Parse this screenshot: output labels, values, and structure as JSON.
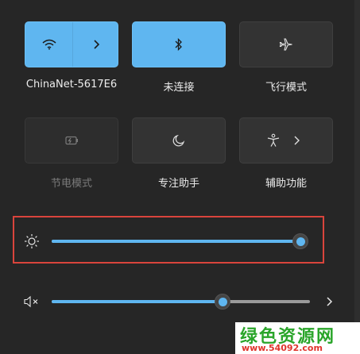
{
  "quick_settings": {
    "tiles": [
      {
        "label": "ChinaNet-5617E6",
        "icon": "wifi-icon",
        "state": "on",
        "has_chevron": true
      },
      {
        "label": "未连接",
        "icon": "bluetooth-icon",
        "state": "on"
      },
      {
        "label": "飞行模式",
        "icon": "airplane-icon",
        "state": "off"
      },
      {
        "label": "节电模式",
        "icon": "battery-saver-icon",
        "state": "disabled"
      },
      {
        "label": "专注助手",
        "icon": "moon-icon",
        "state": "off"
      },
      {
        "label": "辅助功能",
        "icon": "accessibility-icon",
        "state": "off",
        "has_chevron": true
      }
    ]
  },
  "brightness": {
    "icon": "sun-icon",
    "level": 1.0,
    "highlighted": true
  },
  "volume": {
    "icon": "speaker-muted-icon",
    "level": 0.66,
    "expand_icon": "chevron-right-icon"
  },
  "watermark": {
    "title": "绿色资源网",
    "url": "www.54092.com"
  },
  "colors": {
    "accent": "#5fb6f0",
    "highlight_border": "#d9443c",
    "panel": "#262626"
  }
}
